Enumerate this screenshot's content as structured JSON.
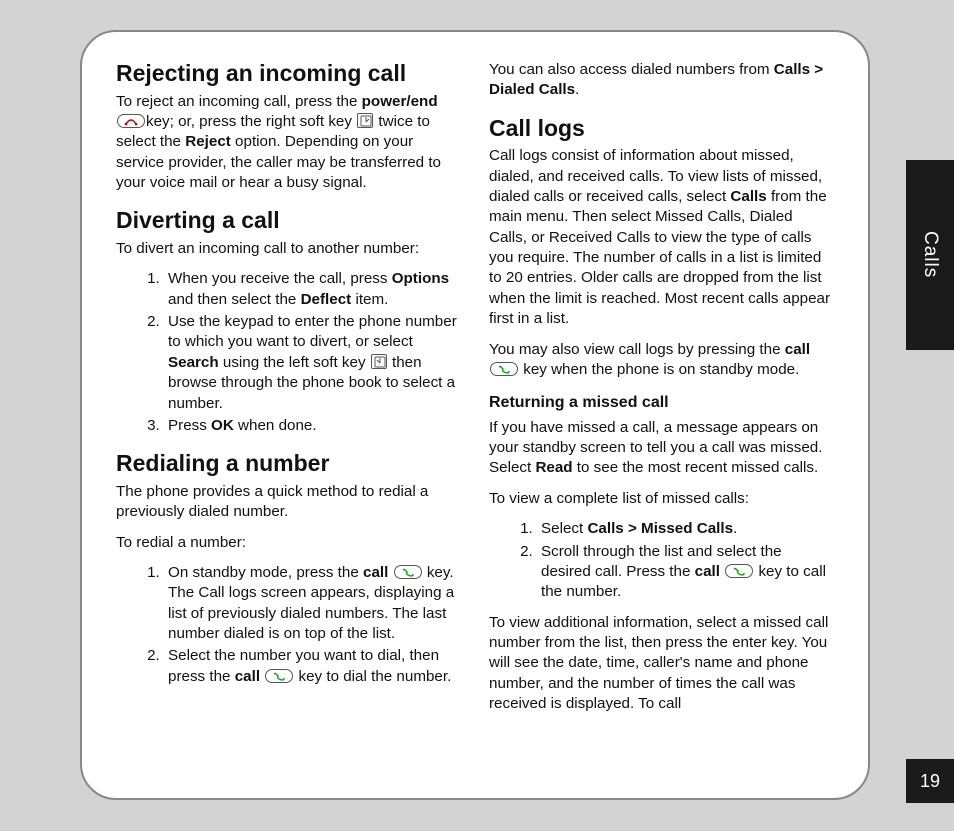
{
  "sideTab": "Calls",
  "pageNumber": "19",
  "left": {
    "h_reject": "Rejecting an incoming call",
    "p_reject_a": "To reject an incoming call, press the ",
    "p_reject_b1": "power/end",
    "p_reject_c": "key; or, press the right soft key ",
    "p_reject_d": " twice to select the ",
    "p_reject_b2": "Reject",
    "p_reject_e": " option. Depending on your service provider, the caller may be transferred to your voice mail or hear a busy signal.",
    "h_divert": "Diverting a call",
    "p_divert_intro": "To divert an incoming call to another number:",
    "divert_1a": "When you receive the call, press ",
    "divert_1b1": "Options",
    "divert_1c": " and then select the ",
    "divert_1b2": "Deflect",
    "divert_1d": " item.",
    "divert_2a": "Use the keypad to enter the phone number to which you want to divert, or select ",
    "divert_2b": "Search",
    "divert_2c": " using the left soft key ",
    "divert_2d": " then browse through the phone book to select a number.",
    "divert_3a": "Press ",
    "divert_3b": "OK",
    "divert_3c": " when done.",
    "h_redial": "Redialing a number",
    "p_redial_intro": "The phone provides a quick method to redial a previously dialed number.",
    "p_redial_to": "To redial a number:",
    "redial_1a": "On standby mode, press the ",
    "redial_1b": "call",
    "redial_1c": " key. The Call logs screen appears, displaying a list of previously dialed numbers. The last number dialed is on top of the list.",
    "redial_2a": "Select the number you want to dial, then press the ",
    "redial_2b": "call",
    "redial_2c": " key to dial the number."
  },
  "right": {
    "p_access_a": "You can also access dialed numbers from ",
    "p_access_b": "Calls > Dialed Calls",
    "p_access_c": ".",
    "h_logs": "Call logs",
    "p_logs_a": "Call logs consist of information about missed, dialed, and received calls. To view lists of missed, dialed calls or received calls, select ",
    "p_logs_b": "Calls",
    "p_logs_c": " from the main menu. Then select Missed Calls, Dialed Calls, or Received Calls to view the type of calls you require. The number of calls in a list is limited to 20 entries. Older calls are dropped from the list when the limit is reached. Most recent calls appear first in a list.",
    "p_logs2_a": "You may also view call logs by pressing the ",
    "p_logs2_b": "call",
    "p_logs2_c": " key when the phone is on standby mode.",
    "h_return": "Returning a missed call",
    "p_return_a": "If you have missed a call, a message appears on your standby screen to tell you a call was missed. Select ",
    "p_return_b": "Read",
    "p_return_c": " to see the most recent missed calls.",
    "p_return_to": "To view a complete list of missed calls:",
    "ret_1a": "Select ",
    "ret_1b": "Calls > Missed Calls",
    "ret_1c": ".",
    "ret_2a": "Scroll through the list and select the desired call. Press the ",
    "ret_2b": "call",
    "ret_2c": " key to call the number.",
    "p_addl": "To view additional information, select a missed call number from the list, then press the enter key. You will see the date, time, caller's name and phone number, and the number of times the call was received is displayed. To call"
  }
}
